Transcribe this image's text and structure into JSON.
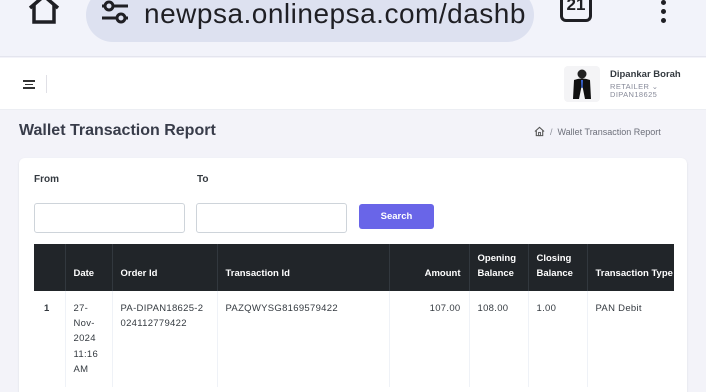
{
  "browser": {
    "url": "newpsa.onlinepsa.com/dashb",
    "tab_count": "21"
  },
  "header": {
    "user_name": "Dipankar Borah",
    "user_role": "RETAILER ⌄",
    "user_id": "DIPAN18625"
  },
  "page": {
    "title": "Wallet Transaction Report",
    "breadcrumb_separator": "/",
    "breadcrumb_current": "Wallet Transaction Report"
  },
  "filters": {
    "from_label": "From",
    "to_label": "To",
    "from_value": "",
    "to_value": "",
    "search_label": "Search"
  },
  "table": {
    "headers": {
      "sn": "",
      "date": "Date",
      "order_id": "Order Id",
      "transaction_id": "Transaction Id",
      "amount": "Amount",
      "opening_balance": "Opening Balance",
      "closing_balance": "Closing Balance",
      "transaction_type": "Transaction Type"
    },
    "rows": [
      {
        "sn": "1",
        "date": "27-Nov-2024 11:16 AM",
        "order_id": "PA-DIPAN18625-2024112779422",
        "transaction_id": "PAZQWYSG8169579422",
        "amount": "107.00",
        "opening_balance": "108.00",
        "closing_balance": "1.00",
        "transaction_type": "PAN Debit"
      }
    ]
  },
  "colors": {
    "accent": "#6965e8",
    "table_header": "#212529",
    "page_background": "#f3f3f9"
  },
  "icons": [
    "home-icon",
    "tune-icon",
    "tabs-icon",
    "kebab-menu-icon",
    "hamburger-menu-icon",
    "avatar",
    "breadcrumb-home-icon"
  ]
}
